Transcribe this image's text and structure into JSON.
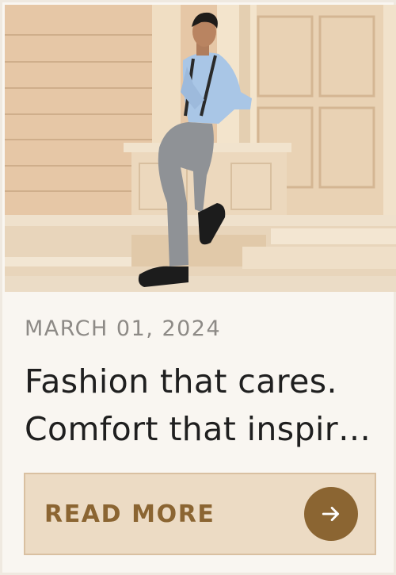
{
  "post": {
    "date": "MARCH 01, 2024",
    "title_line1": "Fashion that cares.",
    "title_line2": "Comfort that inspir…",
    "image_icon": "hero-photo"
  },
  "cta": {
    "label": "READ MORE",
    "icon": "arrow-right-icon"
  },
  "colors": {
    "card_background": "#f9f6f1",
    "button_background": "#ecdbc4",
    "accent": "#8b6532",
    "title_text": "#1f1f1f",
    "date_text": "#8d8a86"
  }
}
